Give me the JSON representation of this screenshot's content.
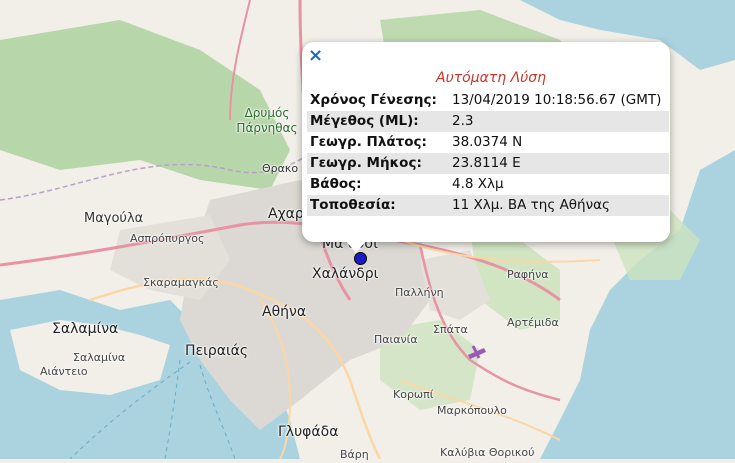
{
  "popup": {
    "close_glyph": "×",
    "title": "Αυτόματη Λύση",
    "rows": [
      {
        "label": "Χρόνος Γένεσης:",
        "value": "13/04/2019 10:18:56.67 (GMT)"
      },
      {
        "label": "Μέγεθος (ML):",
        "value": "2.3"
      },
      {
        "label": "Γεωγρ. Πλάτος:",
        "value": "38.0374 N"
      },
      {
        "label": "Γεωγρ. Μήκος:",
        "value": "23.8114 E"
      },
      {
        "label": "Βάθος:",
        "value": "4.8 Χλμ"
      },
      {
        "label": "Τοποθεσία:",
        "value": "11 Χλμ. ΒΑ της Αθήνας"
      }
    ]
  },
  "map": {
    "labels": {
      "parnitha": "Δρυμός Πάρνηθας",
      "thrako": "Θρακο",
      "magoula": "Μαγούλα",
      "acharnes": "Αχαρ",
      "maroussi": "Μα    ούσι",
      "aspropyrgos": "Ασπρόπυργος",
      "skaramangas": "Σκαραμαγκάς",
      "chalandri": "Χαλάνδρι",
      "rafina": "Ραφήνα",
      "pallini": "Παλλήνη",
      "salamina1": "Σαλαμίνα",
      "athina": "Αθήνα",
      "artemida": "Αρτέμιδα",
      "spata": "Σπάτα",
      "salamina2": "Σαλαμίνα",
      "peiraias": "Πειραιάς",
      "paiania": "Παιανία",
      "aianteio": "Αιάντειο",
      "koropi": "Κορωπί",
      "markopoulo": "Μαρκόπουλο",
      "glyfada": "Γλυφάδα",
      "kalyvia": "Καλύβια Θορικού",
      "vari": "Βάρη"
    },
    "colors": {
      "water": "#aad3df",
      "land": "#f2efe9",
      "urban": "#dcd9d4",
      "forest": "#add19e",
      "park": "#c8facc",
      "motorway": "#e892a2",
      "primary": "#fcd6a4",
      "boundary": "#b7a0c8",
      "marker": "#1a1ac8",
      "popup_title": "#c8352b"
    }
  }
}
